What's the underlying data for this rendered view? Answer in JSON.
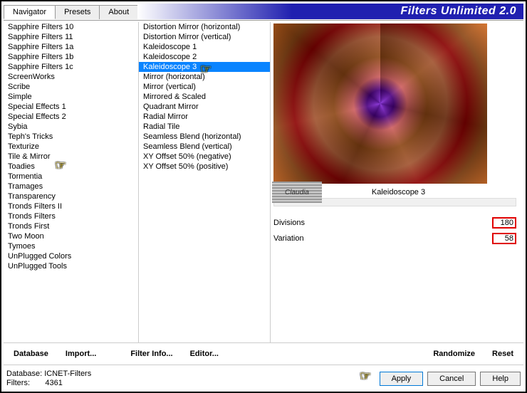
{
  "header": {
    "title": "Filters Unlimited 2.0",
    "tabs": [
      "Navigator",
      "Presets",
      "About"
    ],
    "active_tab": 0
  },
  "left_list": {
    "items": [
      "Sapphire Filters 10",
      "Sapphire Filters 11",
      "Sapphire Filters 1a",
      "Sapphire Filters 1b",
      "Sapphire Filters 1c",
      "ScreenWorks",
      "Scribe",
      "Simple",
      "Special Effects 1",
      "Special Effects 2",
      "Sybia",
      "Teph's Tricks",
      "Texturize",
      "Tile & Mirror",
      "Toadies",
      "Tormentia",
      "Tramages",
      "Transparency",
      "Tronds Filters II",
      "Tronds Filters",
      "Tronds First",
      "Two Moon",
      "Tymoes",
      "UnPlugged Colors",
      "UnPlugged Tools"
    ],
    "selected": 13
  },
  "right_list": {
    "items": [
      "Distortion Mirror (horizontal)",
      "Distortion Mirror (vertical)",
      "Kaleidoscope 1",
      "Kaleidoscope 2",
      "Kaleidoscope 3",
      "Mirror (horizontal)",
      "Mirror (vertical)",
      "Mirrored & Scaled",
      "Quadrant Mirror",
      "Radial Mirror",
      "Radial Tile",
      "Seamless Blend (horizontal)",
      "Seamless Blend (vertical)",
      "XY Offset 50% (negative)",
      "XY Offset 50% (positive)"
    ],
    "selected": 4
  },
  "preview": {
    "filter_name": "Kaleidoscope 3",
    "watermark": "Claudia"
  },
  "params": [
    {
      "label": "Divisions",
      "value": "180"
    },
    {
      "label": "Variation",
      "value": "58"
    }
  ],
  "midbar": {
    "database": "Database",
    "import": "Import...",
    "filter_info": "Filter Info...",
    "editor": "Editor...",
    "randomize": "Randomize",
    "reset": "Reset"
  },
  "footer": {
    "db_label": "Database:",
    "db_value": "ICNET-Filters",
    "filters_label": "Filters:",
    "filters_value": "4361",
    "apply": "Apply",
    "cancel": "Cancel",
    "help": "Help"
  }
}
